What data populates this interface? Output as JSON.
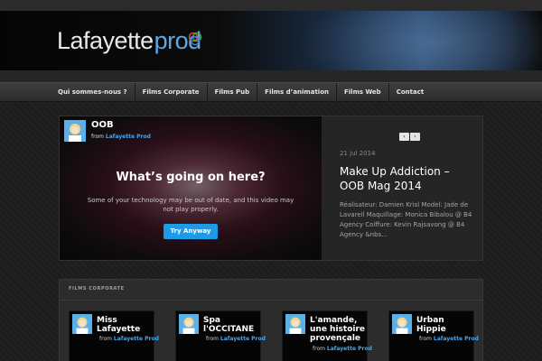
{
  "brand": {
    "name": "Lafayette",
    "suffix": "prod"
  },
  "nav": [
    "Qui sommes-nous ?",
    "Films Corporate",
    "Films Pub",
    "Films d’animation",
    "Films Web",
    "Contact"
  ],
  "feature": {
    "video": {
      "title": "OOB",
      "from_prefix": "from",
      "from_author": "Lafayette Prod",
      "warning_title": "What’s going on here?",
      "warning_text": "Some of your technology may be out of date, and this video may not play properly.",
      "button": "Try Anyway"
    },
    "prev_icon": "‹",
    "next_icon": "›",
    "date": "21 jul 2014",
    "title": "Make Up Addiction – OOB Mag 2014",
    "excerpt": "Réalisateur: Damien Krisl Model: Jade de Lavareil Maquillage: Monica Bibalou @ B4 Agency Coiffure: Kevin Rajsavong @ B4 Agency &nbs..."
  },
  "section": {
    "label": "FILMS CORPORATE",
    "cards": [
      {
        "title": "Miss Lafayette",
        "from_prefix": "from",
        "from_author": "Lafayette Prod"
      },
      {
        "title": "Spa l'OCCITANE",
        "from_prefix": "from",
        "from_author": "Lafayette Prod"
      },
      {
        "title": "L'amande, une histoire provençale",
        "from_prefix": "from",
        "from_author": "Lafayette Prod"
      },
      {
        "title": "Urban Hippie",
        "from_prefix": "from",
        "from_author": "Lafayette Prod"
      }
    ]
  },
  "colors": {
    "accent": "#1e9be6",
    "link": "#49a6ec",
    "brand_suffix": "#5fa8e6"
  },
  "icons": {
    "avatar": "avatar-icon",
    "arrow_prev": "arrow-left-icon",
    "arrow_next": "arrow-right-icon"
  }
}
